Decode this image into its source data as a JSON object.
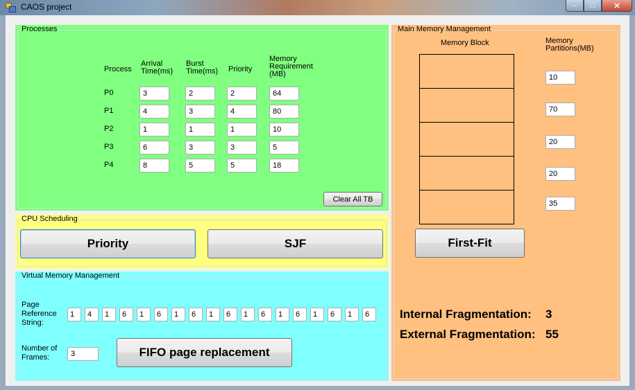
{
  "window": {
    "title": "CAOS project",
    "min_glyph": "‒",
    "max_glyph": "□",
    "close_glyph": "✕"
  },
  "processes": {
    "group_label": "Processes",
    "headers": {
      "process": "Process",
      "arrival": "Arrival Time(ms)",
      "burst": "Burst Time(ms)",
      "priority": "Priority",
      "memory": "Memory Requirement (MB)"
    },
    "rows": [
      {
        "name": "P0",
        "arrival": "3",
        "burst": "2",
        "priority": "2",
        "memory": "64"
      },
      {
        "name": "P1",
        "arrival": "4",
        "burst": "3",
        "priority": "4",
        "memory": "80"
      },
      {
        "name": "P2",
        "arrival": "1",
        "burst": "1",
        "priority": "1",
        "memory": "10"
      },
      {
        "name": "P3",
        "arrival": "6",
        "burst": "3",
        "priority": "3",
        "memory": "5"
      },
      {
        "name": "P4",
        "arrival": "8",
        "burst": "5",
        "priority": "5",
        "memory": "18"
      }
    ],
    "clear_label": "Clear All TB"
  },
  "cpu": {
    "group_label": "CPU Scheduling",
    "priority_label": "Priority",
    "sjf_label": "SJF"
  },
  "vm": {
    "group_label": "Virtual Memory Management",
    "ref_label": "Page Reference String:",
    "ref_string": [
      "1",
      "4",
      "1",
      "6",
      "1",
      "6",
      "1",
      "6",
      "1",
      "6",
      "1",
      "6",
      "1",
      "6",
      "1",
      "6",
      "1",
      "6"
    ],
    "frames_label": "Number of Frames:",
    "frames_value": "3",
    "fifo_label": "FIFO page replacement"
  },
  "mm": {
    "group_label": "Main Memory Management",
    "block_label": "Memory Block",
    "partitions_label": "Memory Partitions(MB)",
    "partitions": [
      "10",
      "70",
      "20",
      "20",
      "35"
    ],
    "first_fit_label": "First-Fit",
    "internal_label": "Internal Fragmentation:",
    "internal_value": "3",
    "external_label": "External Fragmentation:",
    "external_value": "55"
  }
}
